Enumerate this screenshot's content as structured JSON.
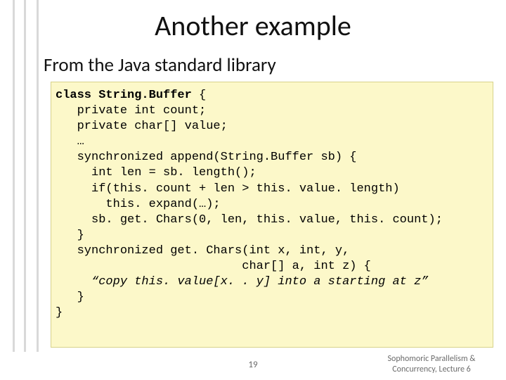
{
  "title": "Another example",
  "subtitle": "From the Java standard library",
  "code": {
    "l01a": "class",
    "l01b": " String.Buffer ",
    "l01c": "{",
    "l02": "   private int count;",
    "l03": "   private char[] value;",
    "l04": "   …",
    "l05": "   synchronized append(String.Buffer sb) {",
    "l06": "     int len = sb. length();",
    "l07": "     if(this. count + len > this. value. length)",
    "l08": "       this. expand(…);",
    "l09": "     sb. get. Chars(0, len, this. value, this. count);",
    "l10": "   }",
    "l11": "   synchronized get. Chars(int x, int, y,",
    "l12": "                          char[] a, int z) {",
    "l13": "     “copy this. value[x. . y] into a starting at z”",
    "l14": "   }",
    "l15": "}"
  },
  "page_number": "19",
  "footer_line1": "Sophomoric Parallelism &",
  "footer_line2": "Concurrency, Lecture 6"
}
